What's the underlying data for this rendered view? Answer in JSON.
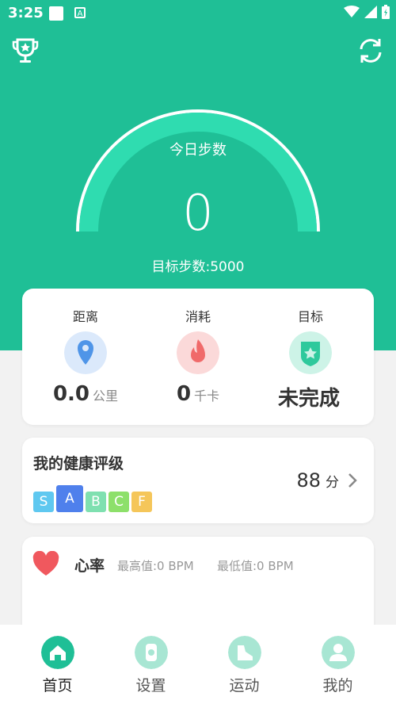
{
  "status": {
    "time": "3:25",
    "badge": "A"
  },
  "header": {
    "trophy_icon": "trophy-icon",
    "sync_icon": "sync-icon"
  },
  "steps": {
    "title": "今日步数",
    "value": "0",
    "goal_text": "目标步数:5000"
  },
  "stats": [
    {
      "label": "距离",
      "value": "0.0",
      "unit": "公里",
      "icon": "location-pin-icon"
    },
    {
      "label": "消耗",
      "value": "0",
      "unit": "千卡",
      "icon": "flame-icon"
    },
    {
      "label": "目标",
      "value": "未完成",
      "unit": "",
      "icon": "shield-star-icon"
    }
  ],
  "health": {
    "title": "我的健康评级",
    "grades": [
      "S",
      "A",
      "B",
      "C",
      "F"
    ],
    "score": "88",
    "score_unit": "分"
  },
  "heart": {
    "title": "心率",
    "max": "最高值:0  BPM",
    "min": "最低值:0  BPM"
  },
  "tabs": [
    {
      "label": "首页",
      "icon": "home-icon"
    },
    {
      "label": "设置",
      "icon": "watch-icon"
    },
    {
      "label": "运动",
      "icon": "sneaker-icon"
    },
    {
      "label": "我的",
      "icon": "user-icon"
    }
  ],
  "colors": {
    "brand": "#1fbf96",
    "gauge_fill": "#2fdcb0"
  }
}
